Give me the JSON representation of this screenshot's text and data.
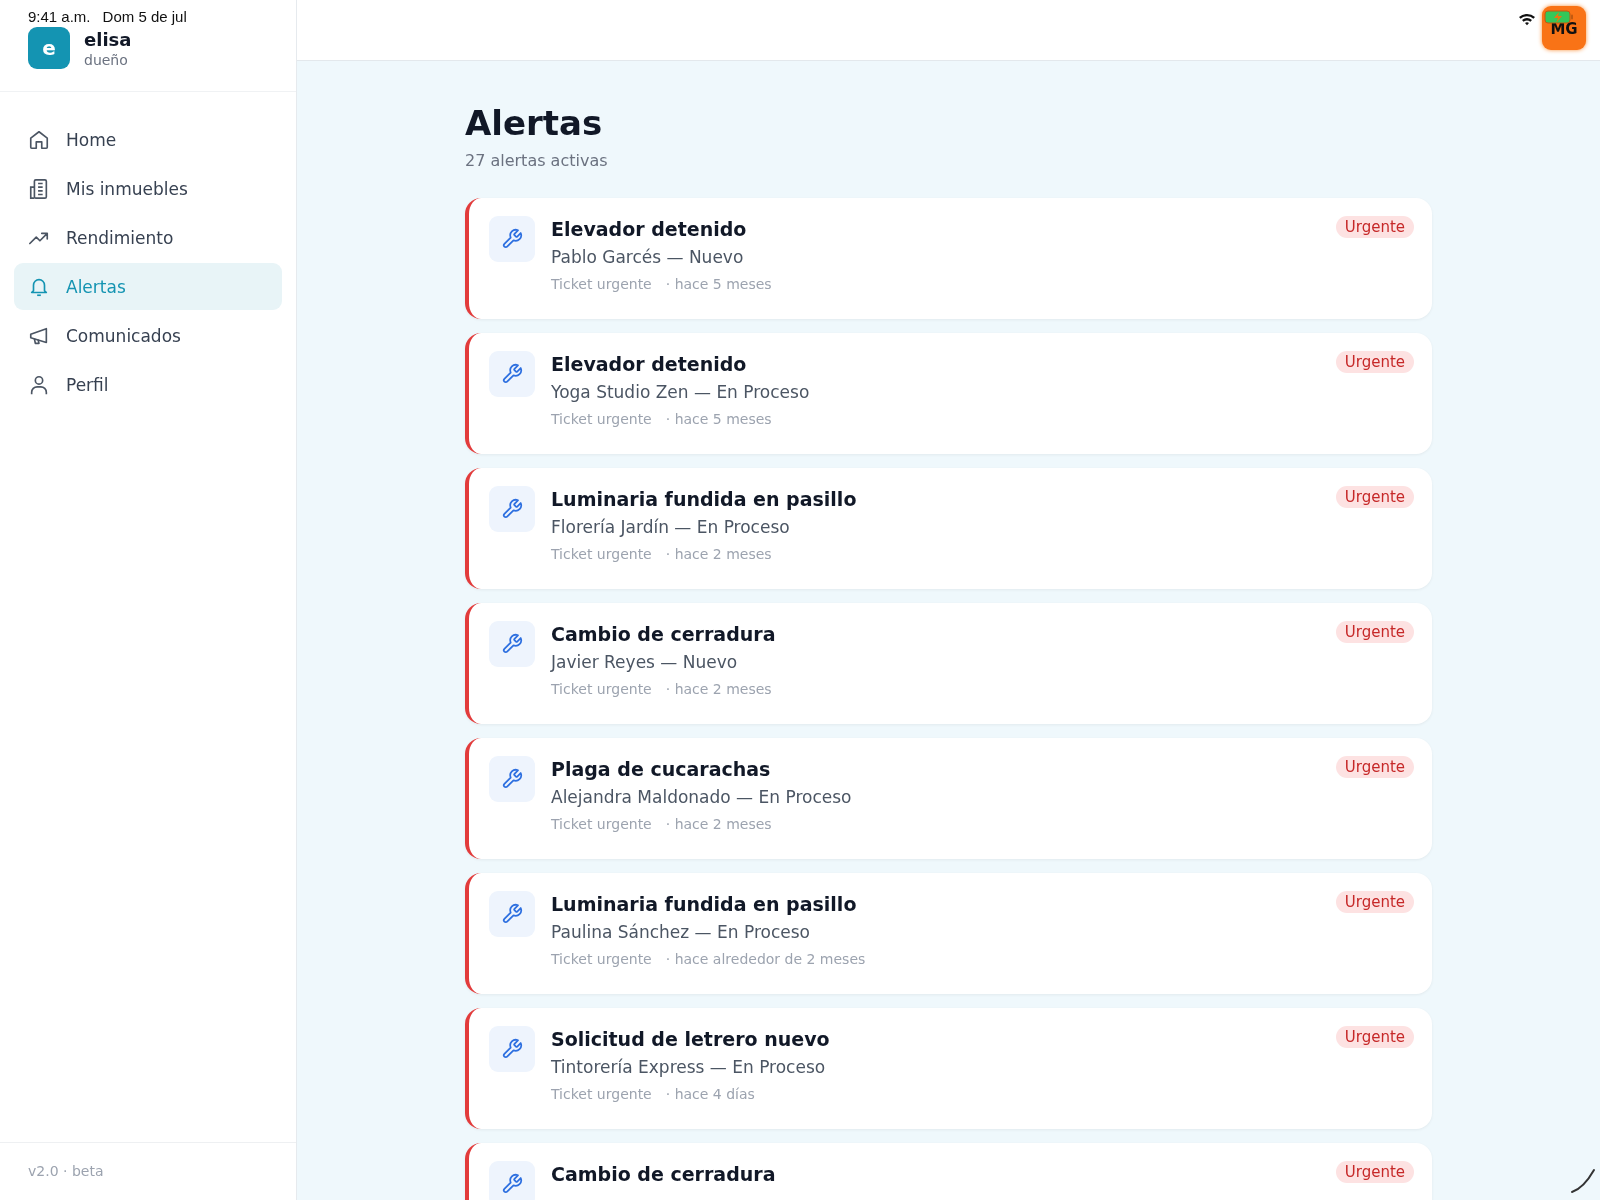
{
  "status_bar": {
    "time": "9:41 a.m.",
    "date": "Dom 5 de jul"
  },
  "user": {
    "initial": "e",
    "name": "elisa",
    "role": "dueño"
  },
  "sidebar": {
    "items": [
      {
        "label": "Home",
        "selected": false
      },
      {
        "label": "Mis inmuebles",
        "selected": false
      },
      {
        "label": "Rendimiento",
        "selected": false
      },
      {
        "label": "Alertas",
        "selected": true
      },
      {
        "label": "Comunicados",
        "selected": false
      },
      {
        "label": "Perfil",
        "selected": false
      }
    ],
    "version": "v2.0 · beta"
  },
  "header": {
    "avatar": "MG"
  },
  "page": {
    "title": "Alertas",
    "subtitle": "27 alertas activas"
  },
  "alerts": [
    {
      "title": "Elevador detenido",
      "detail": "Pablo Garcés — Nuevo",
      "type": "Ticket urgente",
      "time": "· hace 5 meses",
      "badge": "Urgente"
    },
    {
      "title": "Elevador detenido",
      "detail": "Yoga Studio Zen — En Proceso",
      "type": "Ticket urgente",
      "time": "· hace 5 meses",
      "badge": "Urgente"
    },
    {
      "title": "Luminaria fundida en pasillo",
      "detail": "Florería Jardín — En Proceso",
      "type": "Ticket urgente",
      "time": "· hace 2 meses",
      "badge": "Urgente"
    },
    {
      "title": "Cambio de cerradura",
      "detail": "Javier Reyes — Nuevo",
      "type": "Ticket urgente",
      "time": "· hace 2 meses",
      "badge": "Urgente"
    },
    {
      "title": "Plaga de cucarachas",
      "detail": "Alejandra Maldonado — En Proceso",
      "type": "Ticket urgente",
      "time": "· hace 2 meses",
      "badge": "Urgente"
    },
    {
      "title": "Luminaria fundida en pasillo",
      "detail": "Paulina Sánchez — En Proceso",
      "type": "Ticket urgente",
      "time": "· hace alrededor de 2 meses",
      "badge": "Urgente"
    },
    {
      "title": "Solicitud de letrero nuevo",
      "detail": "Tintorería Express — En Proceso",
      "type": "Ticket urgente",
      "time": "· hace 4 días",
      "badge": "Urgente"
    },
    {
      "title": "Cambio de cerradura",
      "badge": "Urgente"
    }
  ]
}
